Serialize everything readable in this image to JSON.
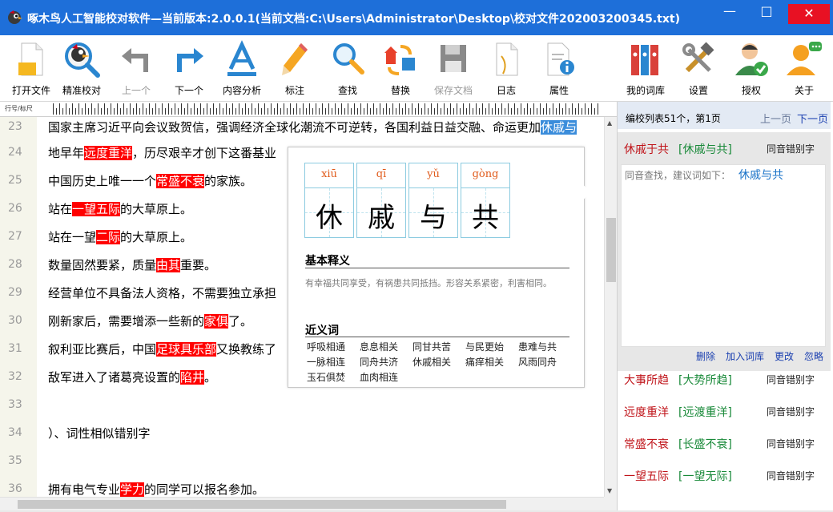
{
  "window": {
    "title": "啄木鸟人工智能校对软件—当前版本:2.0.0.1(当前文档:C:\\Users\\Administrator\\Desktop\\校对文件202003200345.txt)",
    "min_glyph": "—",
    "max_glyph": "□",
    "close_glyph": "✕"
  },
  "toolbar": {
    "open": "打开文件",
    "precise": "精准校对",
    "prev": "上一个",
    "next": "下一个",
    "analysis": "内容分析",
    "mark": "标注",
    "find": "查找",
    "replace": "替换",
    "save": "保存文档",
    "log": "日志",
    "props": "属性",
    "lexicon": "我的词库",
    "settings": "设置",
    "license": "授权",
    "about": "关于"
  },
  "ruler": {
    "label": "行号/标尺"
  },
  "editor": {
    "lines": [
      {
        "num": "23",
        "a": "国家主席习近平向会议致贺信，强调经济全球化潮流不可逆转，各国利益日益交融、命运更加",
        "err": "",
        "sel": "休戚与",
        "c": ""
      },
      {
        "num": "24",
        "a": "地早年",
        "err": "远度重洋",
        "c": "，历尽艰辛才创下这番基业"
      },
      {
        "num": "25",
        "a": "中国历史上唯一一个",
        "err": "常盛不衰",
        "c": "的家族。"
      },
      {
        "num": "26",
        "a": "站在",
        "err": "一望五际",
        "c": "的大草原上。"
      },
      {
        "num": "27",
        "a": "站在一望",
        "err": "二际",
        "c": "的大草原上。"
      },
      {
        "num": "28",
        "a": "数量固然要紧，质量",
        "err": "由其",
        "c": "重要。"
      },
      {
        "num": "29",
        "a": "经营单位不具备法人资格，不需要独立承担",
        "err": "",
        "c": ""
      },
      {
        "num": "30",
        "a": "刚新家后，需要增添一些新的",
        "err": "家俱",
        "c": "了。"
      },
      {
        "num": "31",
        "a": "叙利亚比赛后，中国",
        "err": "足球具乐部",
        "c": "又换教练了"
      },
      {
        "num": "32",
        "a": "敌军进入了诸葛亮设置的",
        "err": "陷井",
        "c": "。"
      },
      {
        "num": "33",
        "a": "",
        "err": "",
        "c": ""
      },
      {
        "num": "34",
        "a": "）、词性相似错别字",
        "err": "",
        "c": ""
      },
      {
        "num": "35",
        "a": "",
        "err": "",
        "c": ""
      },
      {
        "num": "36",
        "a": "拥有电气专业",
        "err": "学力",
        "c": "的同学可以报名参加。"
      }
    ]
  },
  "popup": {
    "chars": [
      {
        "py": "xiū",
        "hz": "休"
      },
      {
        "py": "qī",
        "hz": "戚"
      },
      {
        "py": "yǔ",
        "hz": "与"
      },
      {
        "py": "gòng",
        "hz": "共"
      }
    ],
    "basic_title": "基本释义",
    "definition": "有幸福共同享受，有祸患共同抵挡。形容关系紧密，利害相同。",
    "syn_title": "近义词",
    "synonyms": [
      "呼吸相通",
      "息息相关",
      "同甘共苦",
      "与民更始",
      "患难与共",
      "一脉相连",
      "同舟共济",
      "休戚相关",
      "痛痒相关",
      "风雨同舟",
      "玉石俱焚",
      "血肉相连"
    ]
  },
  "sidebar": {
    "info": "编校列表51个，第1页",
    "prev": "上一页",
    "next": "下一页",
    "current": {
      "wrong": "休戚于共",
      "suggest": "[休戚与共]",
      "type": "同音错别字"
    },
    "detail": {
      "query": "同音查找，建议词如下：",
      "suggestion": "休戚与共"
    },
    "actions": {
      "delete": "删除",
      "add": "加入词库",
      "change": "更改",
      "ignore": "忽略"
    },
    "items": [
      {
        "wrong": "大事所趋",
        "suggest": "[大势所趋]",
        "type": "同音错别字"
      },
      {
        "wrong": "远度重洋",
        "suggest": "[远渡重洋]",
        "type": "同音错别字"
      },
      {
        "wrong": "常盛不衰",
        "suggest": "[长盛不衰]",
        "type": "同音错别字"
      },
      {
        "wrong": "一望五际",
        "suggest": "[一望无际]",
        "type": "同音错别字"
      }
    ]
  }
}
